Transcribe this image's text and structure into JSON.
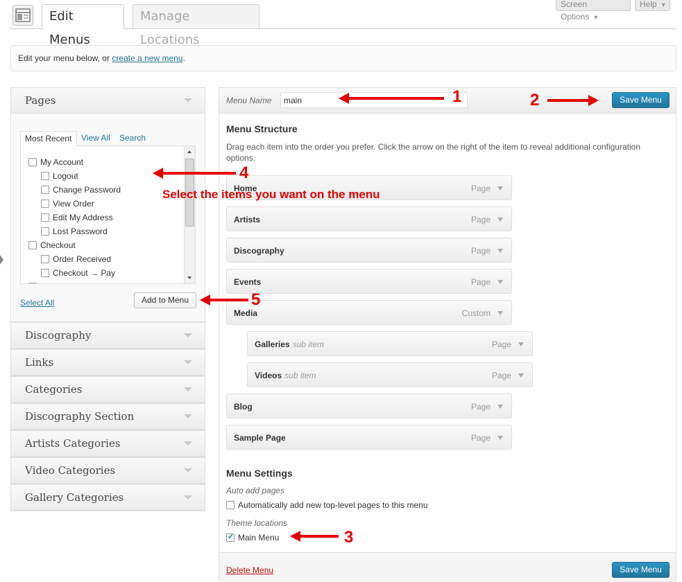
{
  "tabs": {
    "active": "Edit Menus",
    "inactive": "Manage Locations"
  },
  "top_buttons": {
    "screen_options": "Screen Options",
    "help": "Help"
  },
  "notice": {
    "prefix": "Edit your menu below, or ",
    "link": "create a new menu",
    "suffix": "."
  },
  "pages_box": {
    "title": "Pages",
    "subtabs": [
      "Most Recent",
      "View All",
      "Search"
    ],
    "items": [
      {
        "label": "My Account",
        "indent": 0
      },
      {
        "label": "Logout",
        "indent": 1
      },
      {
        "label": "Change Password",
        "indent": 1
      },
      {
        "label": "View Order",
        "indent": 1
      },
      {
        "label": "Edit My Address",
        "indent": 1
      },
      {
        "label": "Lost Password",
        "indent": 1
      },
      {
        "label": "Checkout",
        "indent": 0
      },
      {
        "label": "Order Received",
        "indent": 1
      },
      {
        "label": "Checkout → Pay",
        "indent": 1
      }
    ],
    "select_all": "Select All",
    "add_to_menu": "Add to Menu"
  },
  "other_boxes": [
    "Discography",
    "Links",
    "Categories",
    "Discography Section",
    "Artists Categories",
    "Video Categories",
    "Gallery Categories"
  ],
  "menu": {
    "name_label": "Menu Name",
    "name_value": "main",
    "save_label": "Save Menu",
    "structure_title": "Menu Structure",
    "instructions": "Drag each item into the order you prefer. Click the arrow on the right of the item to reveal additional configuration options.",
    "items": [
      {
        "label": "Home",
        "type": "Page",
        "sub": ""
      },
      {
        "label": "Artists",
        "type": "Page",
        "sub": ""
      },
      {
        "label": "Discography",
        "type": "Page",
        "sub": ""
      },
      {
        "label": "Events",
        "type": "Page",
        "sub": ""
      },
      {
        "label": "Media",
        "type": "Custom",
        "sub": ""
      },
      {
        "label": "Galleries",
        "type": "Page",
        "sub": "sub item"
      },
      {
        "label": "Videos",
        "type": "Page",
        "sub": "sub item"
      },
      {
        "label": "Blog",
        "type": "Page",
        "sub": ""
      },
      {
        "label": "Sample Page",
        "type": "Page",
        "sub": ""
      }
    ],
    "settings_title": "Menu Settings",
    "auto_add_label": "Auto add pages",
    "auto_add_option": "Automatically add new top-level pages to this menu",
    "theme_locations_label": "Theme locations",
    "theme_location_option": "Main Menu",
    "delete_label": "Delete Menu"
  },
  "annotations": {
    "n1": "1",
    "n2": "2",
    "n3": "3",
    "n4": "4",
    "n5": "5",
    "select_text": "Select the items you want on the menu"
  },
  "colors": {
    "accent_blue": "#21759b",
    "annotation_red": "#e50000",
    "delete_red": "#bc0b0b"
  }
}
